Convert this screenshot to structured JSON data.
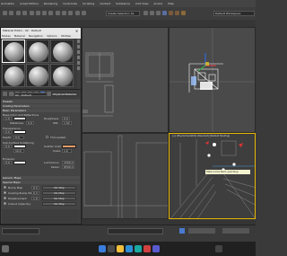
{
  "menubar": {
    "items": [
      "Animation",
      "Graph Editors",
      "Rendering",
      "Customize",
      "Scripting",
      "Content",
      "Substance",
      "Civil View",
      "Arnold",
      "Help"
    ]
  },
  "toolbar": {
    "selection_set": "Create Selection Se",
    "workspace": "Default Workspace"
  },
  "viewports": {
    "top_left_label": "",
    "camera_label": "[+] [PhysCamera001] [Standard] [Default Shading]",
    "tooltip": "Table 2.max Nozz: (pending)"
  },
  "material_editor": {
    "title": "Material Editor - 02 - Default",
    "menu": [
      "Modes",
      "Material",
      "Navigation",
      "Options",
      "Utilities"
    ],
    "name_value": "02 - Default",
    "type_button": "Physical Material",
    "rollouts": {
      "presets": "Presets",
      "coating": "Coating Parameters",
      "basic": "Basic Parameters",
      "maps": "Generic Maps",
      "special": "Special Maps"
    },
    "basic": {
      "base_label": "Base Color and Reflections",
      "base_value": "1.0",
      "roughness_label": "Roughness",
      "roughness_value": "0.0",
      "metalness_label": "Metalness",
      "metalness_value": "0.0",
      "ior_label": "IOR:",
      "ior_value": "1.52",
      "transparency_label": "Transparency",
      "transparency_value": "0.0",
      "depth_label": "Depth:",
      "depth_value": "0.0",
      "thin_label": "Thin-walled",
      "sss_label": "Sub-Surface Scattering",
      "sss_value": "0.0",
      "scatter_color_label": "Scatter Color",
      "sss_depth_value": "10.0",
      "sss_scale_label": "Scale:",
      "sss_scale_value": "1.0",
      "emission_label": "Emission",
      "emission_value": "0.0",
      "luminance_label": "Luminance",
      "luminance_value": "1500.0",
      "kelvin_label": "Kelvin:",
      "kelvin_value": "6500.0"
    },
    "special": {
      "bump_label": "Bump Map",
      "bump_value": "0.3",
      "coating_bump_label": "Coating Bump Map",
      "coating_bump_value": "0.3",
      "displacement_label": "Displacement",
      "displacement_value": "1.0",
      "cutout_label": "Cutout (Opacity)",
      "no_map": "No Map"
    }
  },
  "statusbar": {
    "left": ""
  },
  "colors": {
    "accent_blue": "#3b7ddd",
    "scatter_color": "#e49b6b",
    "base_color": "#d9d9d9",
    "gizmo_red": "#d33"
  }
}
